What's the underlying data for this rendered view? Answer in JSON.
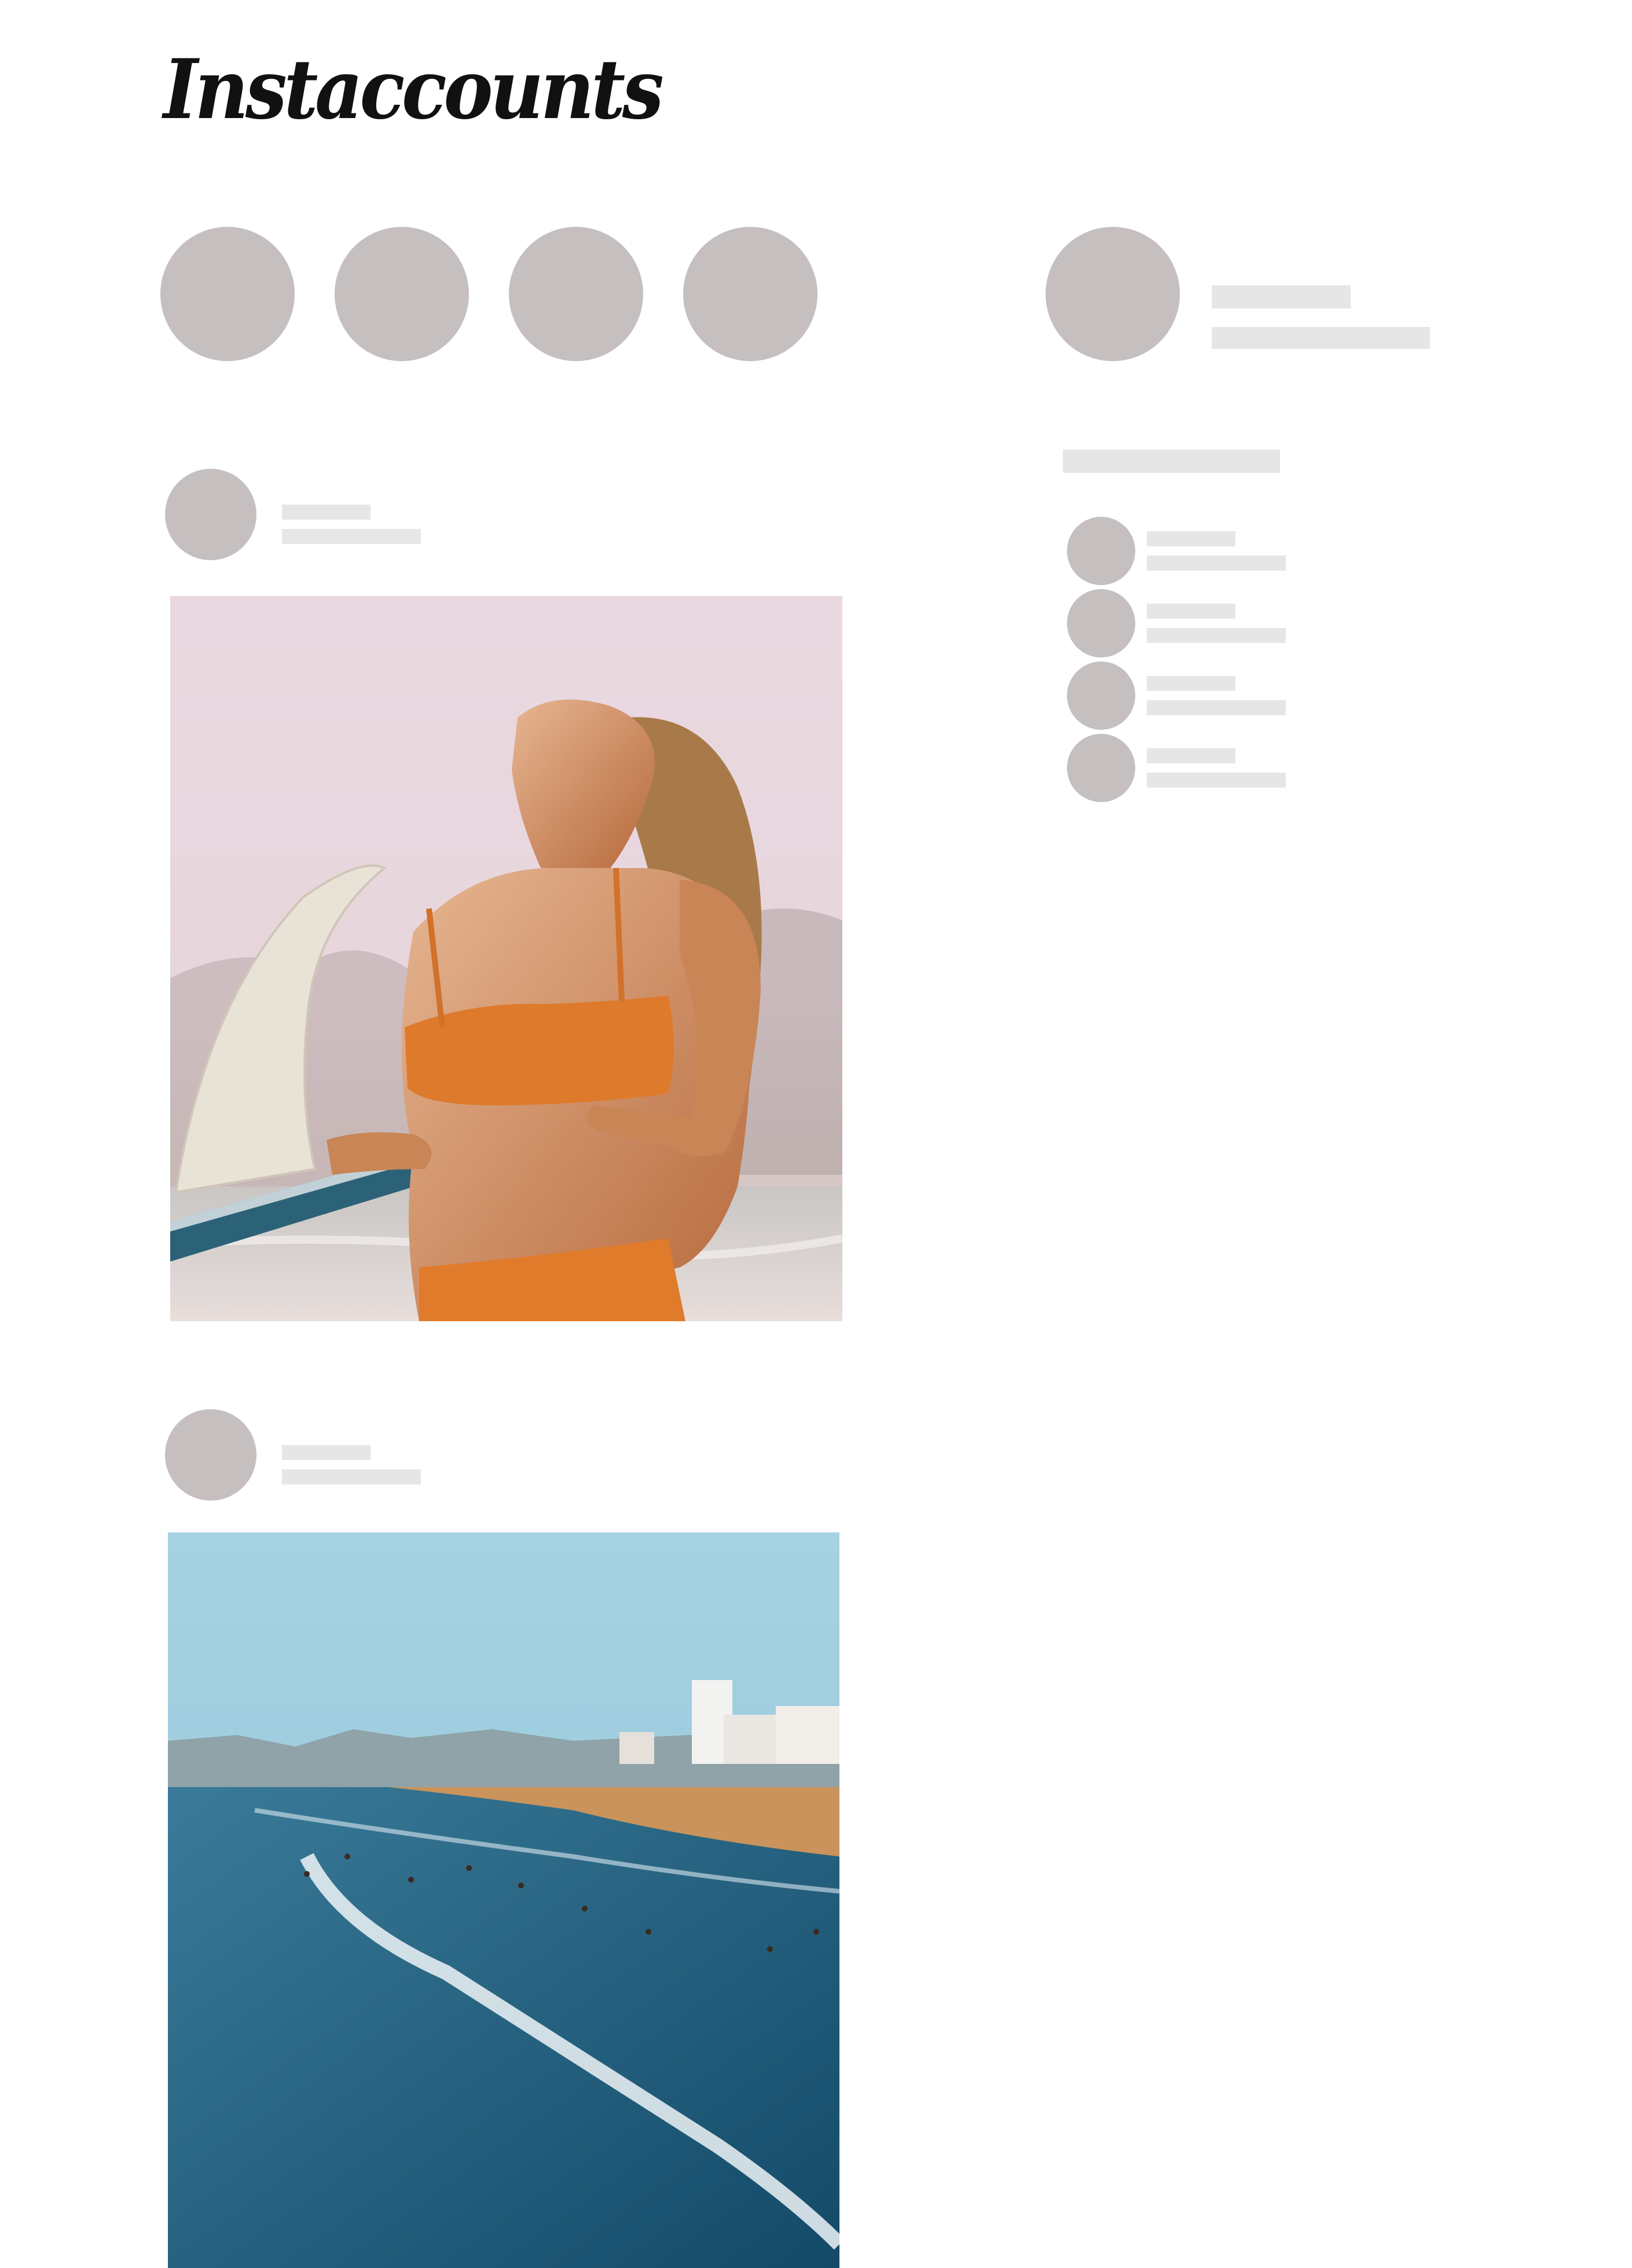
{
  "app": {
    "logo_text": "Instaccounts"
  },
  "colors": {
    "avatar_placeholder": "#c5bfc0",
    "skeleton_bar": "#e7e6e6",
    "background": "#ffffff"
  },
  "stories": {
    "count": 4
  },
  "sidebar": {
    "suggestions_count": 4
  },
  "feed": {
    "posts": [
      {
        "image_description_icon": "surfer-photo"
      },
      {
        "image_description_icon": "beach-photo"
      }
    ]
  }
}
